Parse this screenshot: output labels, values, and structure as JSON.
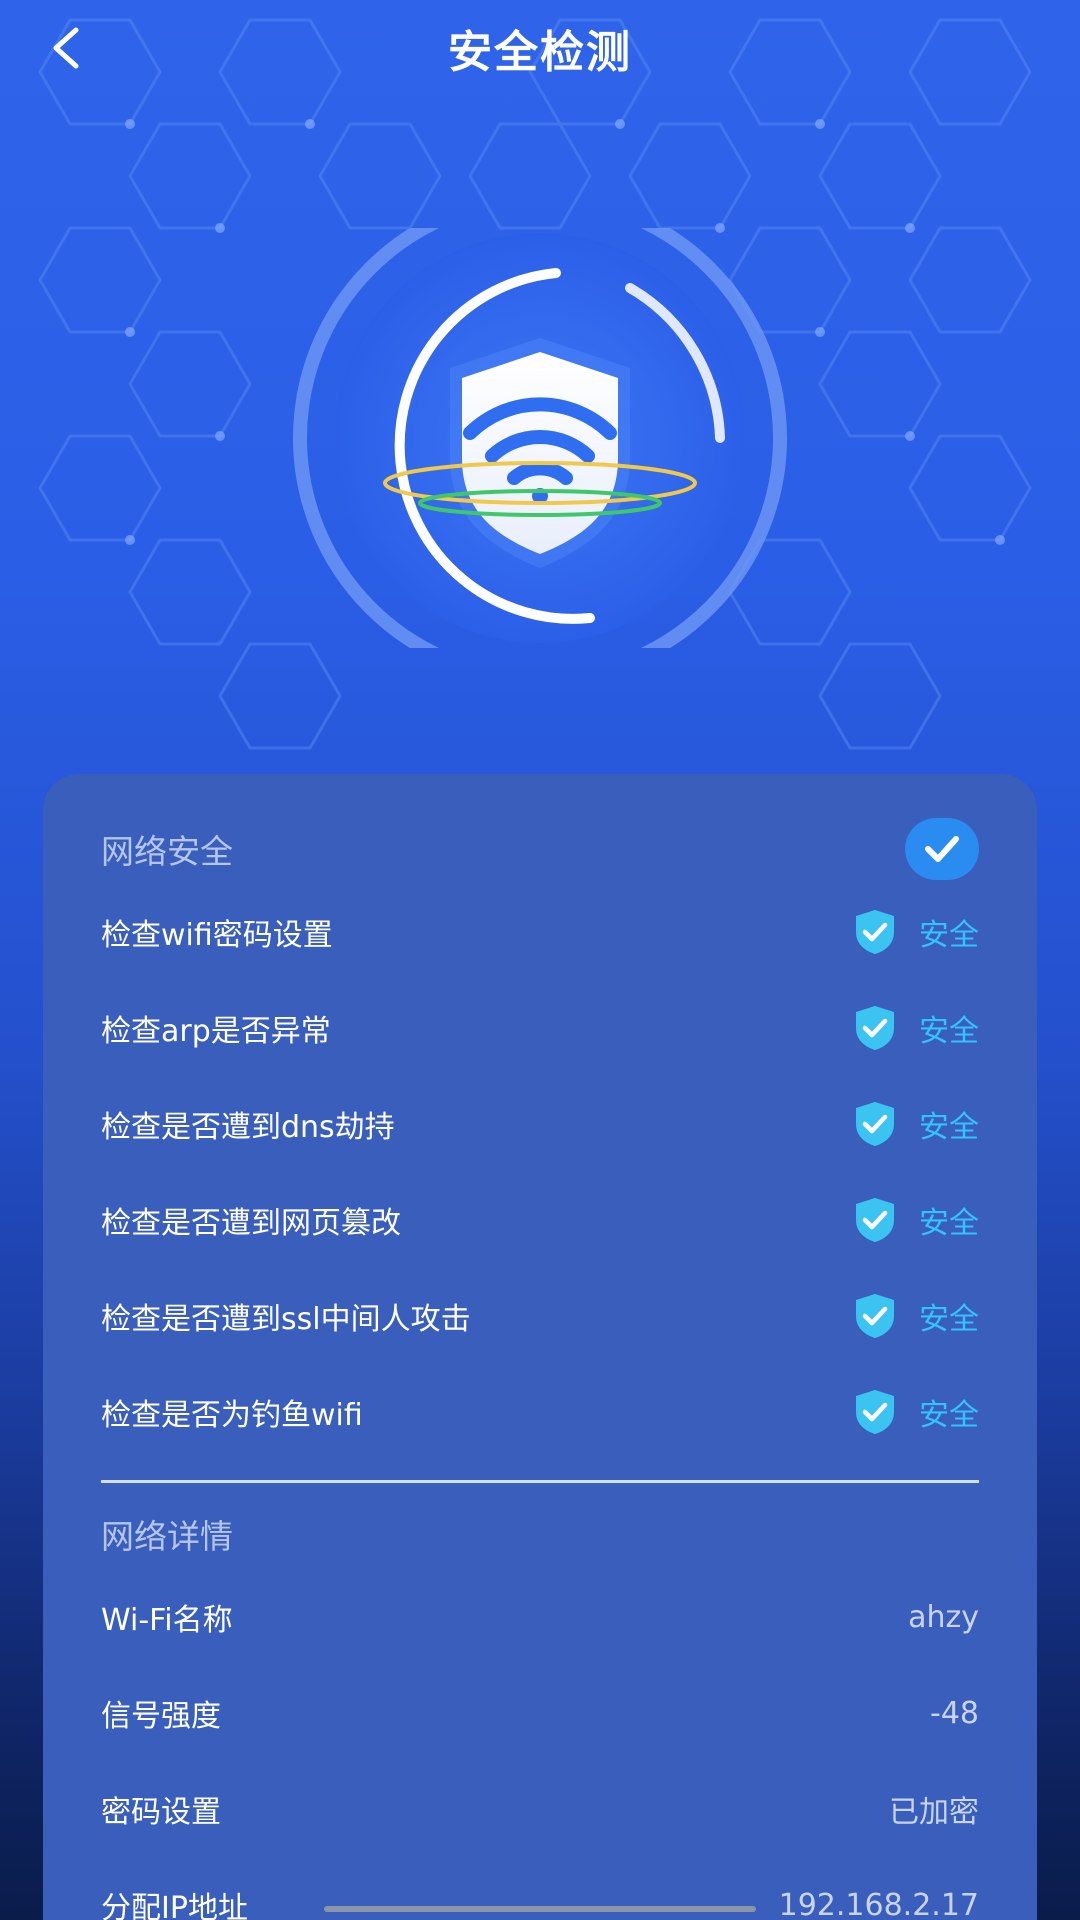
{
  "header": {
    "title": "安全检测"
  },
  "security": {
    "title": "网络安全",
    "items": [
      {
        "label": "检查wifi密码设置",
        "status": "安全"
      },
      {
        "label": "检查arp是否异常",
        "status": "安全"
      },
      {
        "label": "检查是否遭到dns劫持",
        "status": "安全"
      },
      {
        "label": "检查是否遭到网页篡改",
        "status": "安全"
      },
      {
        "label": "检查是否遭到ssl中间人攻击",
        "status": "安全"
      },
      {
        "label": "检查是否为钓鱼wifi",
        "status": "安全"
      }
    ]
  },
  "details": {
    "title": "网络详情",
    "items": [
      {
        "label": "Wi-Fi名称",
        "value": "ahzy"
      },
      {
        "label": "信号强度",
        "value": "-48"
      },
      {
        "label": "密码设置",
        "value": "已加密"
      },
      {
        "label": "分配IP地址",
        "value": "192.168.2.17"
      }
    ]
  },
  "icons": {
    "back": "chevron-left-icon",
    "scan": "wifi-shield-icon",
    "check": "check-icon",
    "shield": "shield-check-icon"
  },
  "colors": {
    "accent": "#33c3ff",
    "card": "#3a5ebb",
    "check_circle": "#2a8cf0"
  }
}
